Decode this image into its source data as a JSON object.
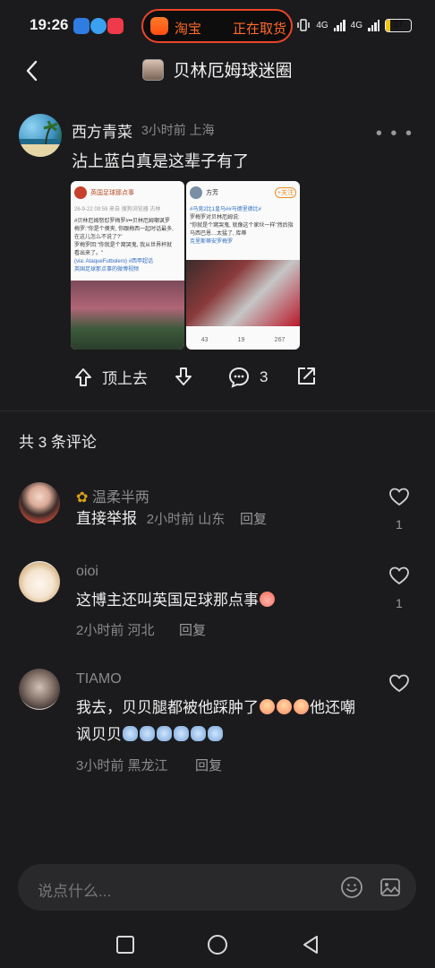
{
  "status_bar": {
    "time": "19:26",
    "live_app": "淘宝",
    "live_status": "正在取货",
    "network_1": "4G",
    "network_2": "4G",
    "battery": "17"
  },
  "header": {
    "title": "贝林厄姆球迷圈"
  },
  "post": {
    "author": "西方青菜",
    "meta": "3小时前 上海",
    "content": "沾上蓝白真是这辈子有了",
    "image1": {
      "account": "英国足球那点事",
      "date": "26-9-22 09:59 来自 搜狗浏览器 古林",
      "lines": [
        "#贝林厄姆怒怼罗梅罗#••贝林厄姆嘲讽罗",
        "梅罗:\"你是个傻夹, 你跟梅西一起时话最多,",
        "在这儿怎么不说了?\"",
        "罗梅罗回:\"你就是个窝哭鬼, 我从世界杯就",
        "看出来了。\"",
        "(via: AtaqueFutbolero) #西甲超话",
        "英国足球那点事的微博视频"
      ]
    },
    "image2": {
      "account": "方芳",
      "follow": "+关注",
      "lines": [
        "#马竞2比1皇马##马德里德比#",
        "罗梅罗对贝林厄姆说:",
        "\"你就是个窝哭鬼, 就像这个家伙一样\"然后指",
        "马西巴恩…太猛了, 库蒂",
        "克里斯蒂安罗梅罗"
      ],
      "stats": [
        "43",
        "19",
        "267"
      ]
    }
  },
  "actions": {
    "top_label": "顶上去",
    "comment_count": "3"
  },
  "comments_header": "共 3 条评论",
  "comments": [
    {
      "name": "温柔半两",
      "text": "直接举报",
      "meta": "2小时前 山东",
      "reply": "回复",
      "likes": "1"
    },
    {
      "name": "oioi",
      "text": "这博主还叫英国足球那点事",
      "meta": "2小时前 河北",
      "reply": "回复",
      "likes": "1"
    },
    {
      "name": "TIAMO",
      "text": "我去，贝贝腿都被他踩肿了",
      "text_2": "他还嘲",
      "text_3": "讽贝贝",
      "meta": "3小时前 黑龙江",
      "reply": "回复",
      "likes": ""
    }
  ],
  "input": {
    "placeholder": "说点什么..."
  }
}
